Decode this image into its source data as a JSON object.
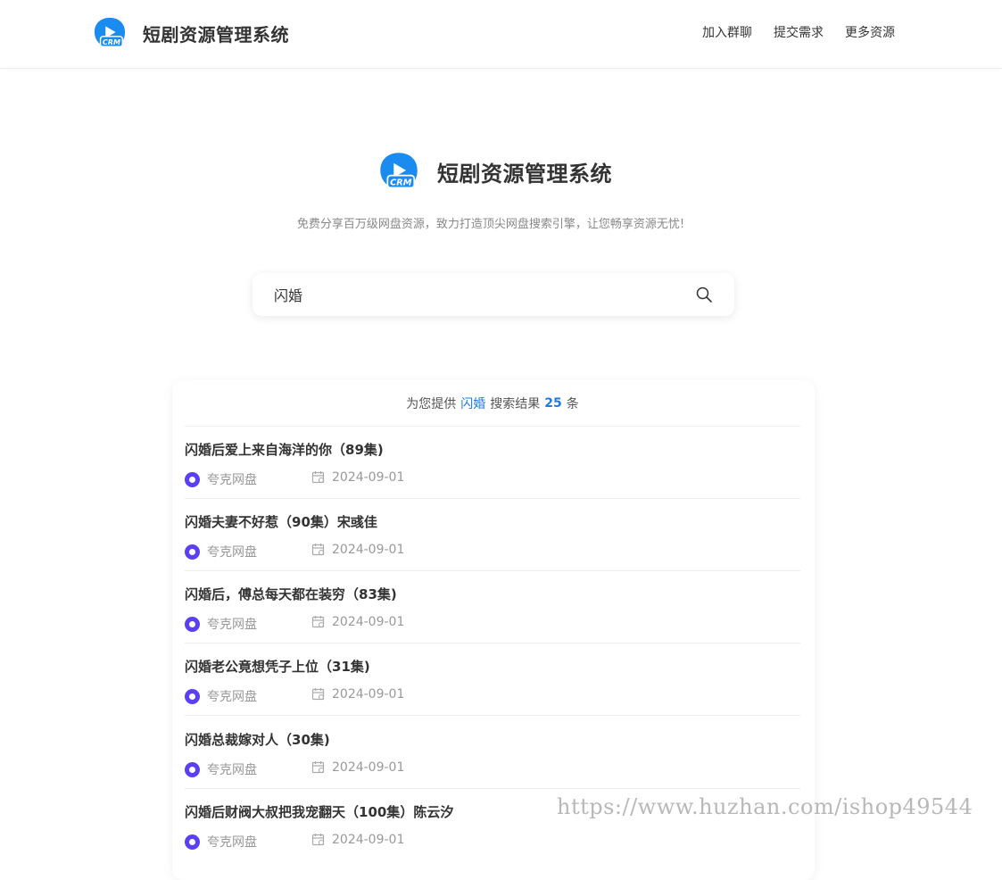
{
  "header": {
    "brand_title": "短剧资源管理系统",
    "logo_text": "CRM",
    "nav": [
      "加入群聊",
      "提交需求",
      "更多资源"
    ]
  },
  "hero": {
    "brand_title": "短剧资源管理系统",
    "tagline": "免费分享百万级网盘资源，致力打造顶尖网盘搜索引擎，让您畅享资源无忧!"
  },
  "search": {
    "value": "闪婚",
    "placeholder": ""
  },
  "results": {
    "summary_prefix": "为您提供",
    "keyword": "闪婚",
    "summary_mid": "搜索结果",
    "count": "25",
    "summary_suffix": "条",
    "items": [
      {
        "title": "闪婚后爱上来自海洋的你（89集)",
        "source": "夸克网盘",
        "date": "2024-09-01"
      },
      {
        "title": "闪婚夫妻不好惹（90集）宋彧佳",
        "source": "夸克网盘",
        "date": "2024-09-01"
      },
      {
        "title": "闪婚后，傅总每天都在装穷（83集)",
        "source": "夸克网盘",
        "date": "2024-09-01"
      },
      {
        "title": "闪婚老公竟想凭子上位（31集)",
        "source": "夸克网盘",
        "date": "2024-09-01"
      },
      {
        "title": "闪婚总裁嫁对人（30集)",
        "source": "夸克网盘",
        "date": "2024-09-01"
      },
      {
        "title": "闪婚后财阀大叔把我宠翻天（100集）陈云汐",
        "source": "夸克网盘",
        "date": "2024-09-01"
      }
    ]
  },
  "colors": {
    "accent": "#1e7be6",
    "pan_icon": "#5a3ff3",
    "logo_blue": "#1a8cf0"
  },
  "watermark": "https://www.huzhan.com/ishop49544"
}
